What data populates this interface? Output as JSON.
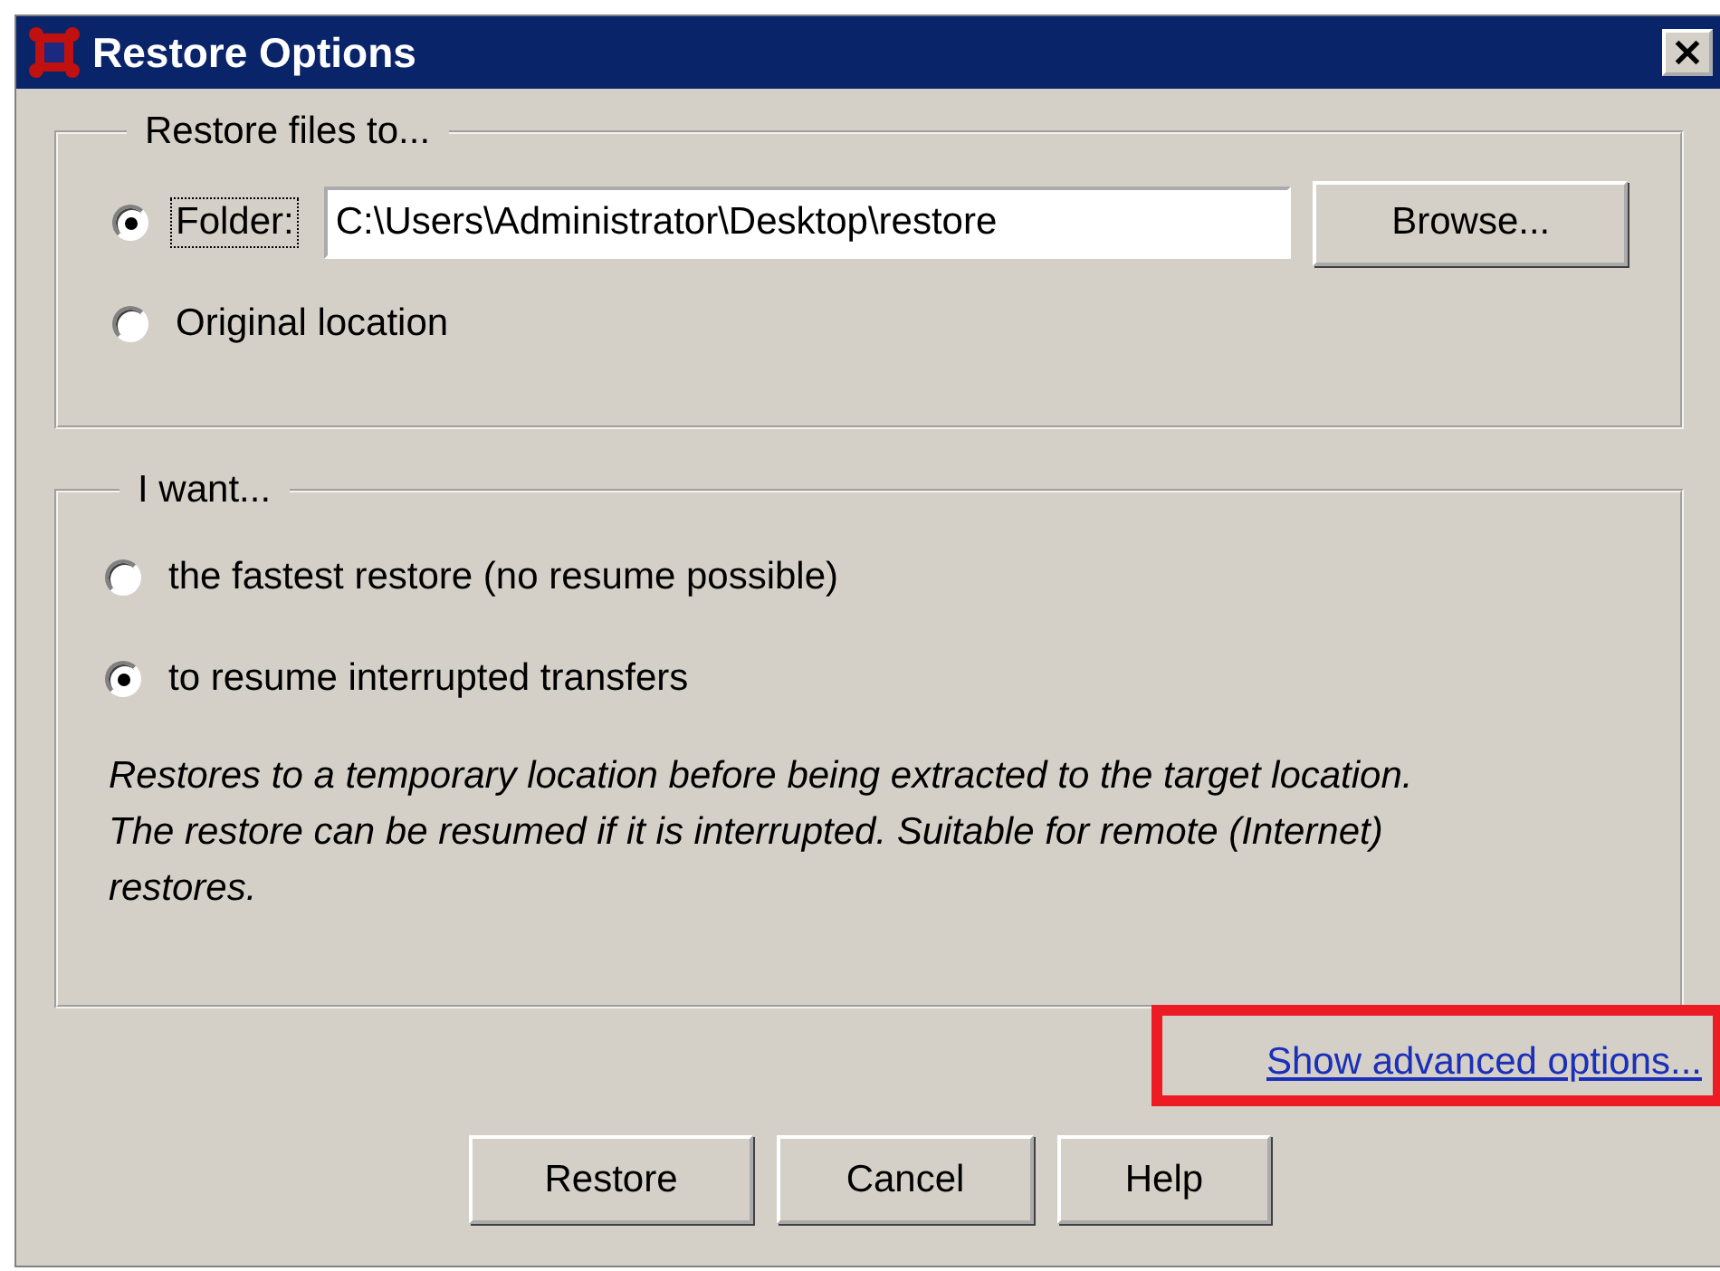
{
  "window": {
    "title": "Restore Options"
  },
  "destination": {
    "legend": "Restore files to...",
    "options": [
      {
        "label": "Folder:",
        "selected": true,
        "focused": true,
        "kind": "folder"
      },
      {
        "label": "Original location",
        "selected": false,
        "focused": false,
        "kind": "plain"
      }
    ],
    "folder_path": "C:\\Users\\Administrator\\Desktop\\restore",
    "browse_button": "Browse..."
  },
  "mode": {
    "legend": "I want...",
    "options": [
      {
        "label": "the fastest restore (no resume possible)",
        "selected": false
      },
      {
        "label": "to resume interrupted transfers",
        "selected": true
      }
    ],
    "description": "Restores to a temporary location before being extracted to the target location.\nThe restore can be resumed if it is interrupted. Suitable for remote (Internet)\nrestores."
  },
  "advanced_link": {
    "label": "Show advanced options...",
    "highlighted": true
  },
  "buttons": [
    "Restore",
    "Cancel",
    "Help"
  ]
}
